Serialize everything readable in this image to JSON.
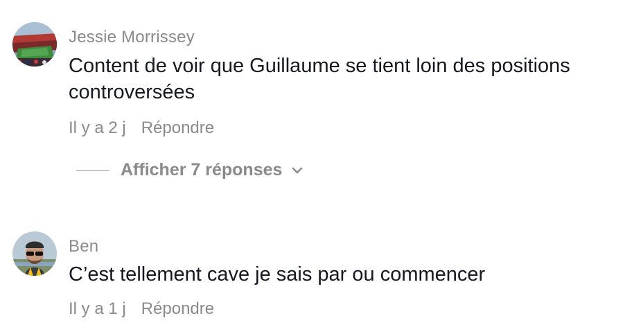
{
  "comments": [
    {
      "author": "Jessie Morrissey",
      "text": "Content de voir que Guillaume se tient loin des positions controversées",
      "time": "Il y a 2 j",
      "reply_label": "Répondre",
      "avatar_icon": "stadium-photo-avatar",
      "replies_label": "Afficher 7 réponses"
    },
    {
      "author": "Ben",
      "text": "C’est tellement cave je sais par ou commencer",
      "time": "Il y a 1 j",
      "reply_label": "Répondre",
      "avatar_icon": "man-sunglasses-photo-avatar"
    }
  ],
  "colors": {
    "text": "#161823",
    "muted": "#8a8a8a",
    "divider": "#c8c8c8"
  }
}
